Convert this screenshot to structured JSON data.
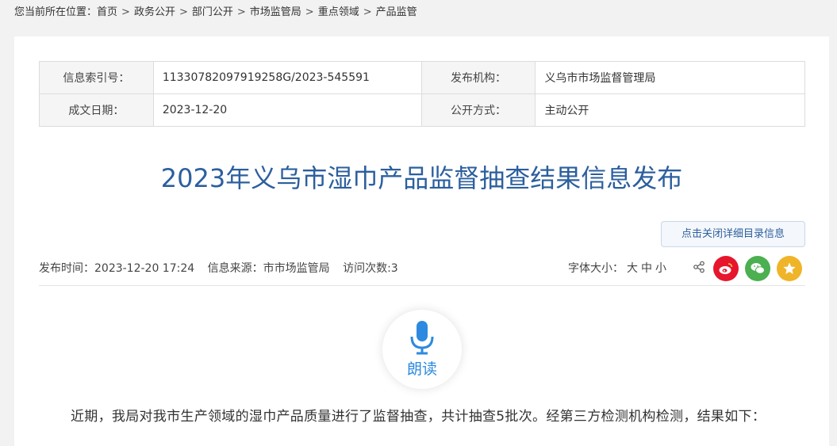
{
  "breadcrumb": {
    "lead": "您当前所在位置：",
    "items": [
      "首页",
      "政务公开",
      "部门公开",
      "市场监管局",
      "重点领域",
      "产品监管"
    ]
  },
  "meta": {
    "index_label": "信息索引号：",
    "index_value": "11330782097919258G/2023-545591",
    "org_label": "发布机构：",
    "org_value": "义乌市市场监督管理局",
    "date_label": "成文日期：",
    "date_value": "2023-12-20",
    "mode_label": "公开方式：",
    "mode_value": "主动公开"
  },
  "title": "2023年义乌市湿巾产品监督抽查结果信息发布",
  "directory_button": "点击关闭详细目录信息",
  "info": {
    "publish_time": "发布时间：2023-12-20 17:24",
    "source": "信息来源：市市场监管局",
    "visits": "访问次数:3"
  },
  "font_size": {
    "label": "字体大小：",
    "large": "大",
    "medium": "中",
    "small": "小"
  },
  "read_aloud": "朗读",
  "paragraph": "近期，我局对我市生产领域的湿巾产品质量进行了监督抽查，共计抽查5批次。经第三方检测机构检测，结果如下：",
  "colors": {
    "title": "#2c5f9e",
    "weibo": "#e6162d",
    "wechat": "#4caf50",
    "favorite": "#f0b429",
    "read_icon": "#2d8ae0"
  }
}
